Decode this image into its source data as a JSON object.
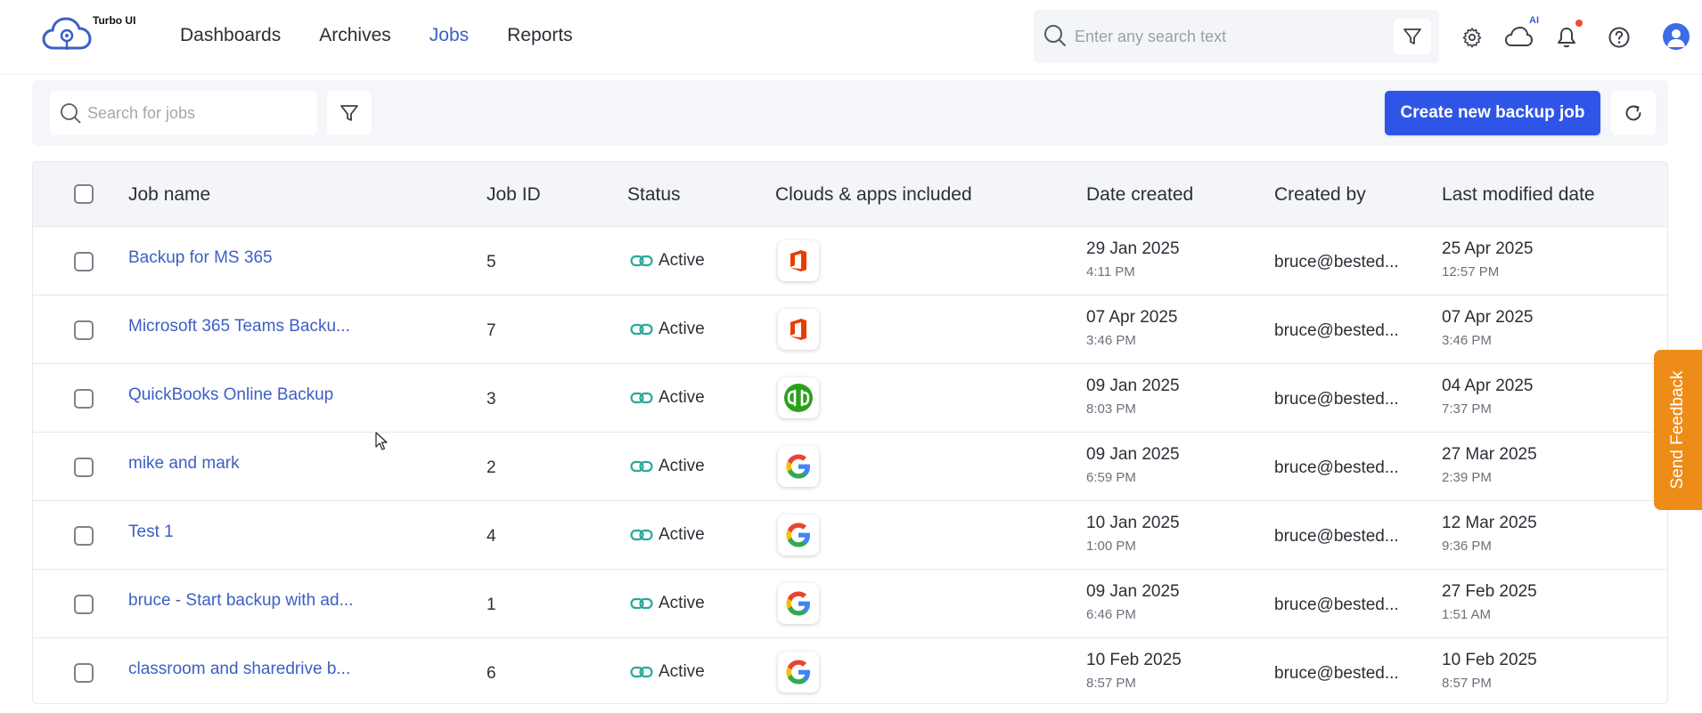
{
  "app": {
    "name": "Turbo UI"
  },
  "nav": {
    "items": [
      "Dashboards",
      "Archives",
      "Jobs",
      "Reports"
    ],
    "active": "Jobs"
  },
  "header": {
    "search_placeholder": "Enter any search text",
    "ai_badge": "AI"
  },
  "toolbar": {
    "search_placeholder": "Search for jobs",
    "create_label": "Create new backup job"
  },
  "table": {
    "columns": [
      "Job name",
      "Job ID",
      "Status",
      "Clouds & apps included",
      "Date created",
      "Created by",
      "Last modified date"
    ],
    "rows": [
      {
        "name": "Backup for MS 365",
        "id": "5",
        "status": "Active",
        "app": "office",
        "created_date": "29 Jan 2025",
        "created_time": "4:11 PM",
        "created_by": "bruce@bested...",
        "modified_date": "25 Apr 2025",
        "modified_time": "12:57 PM"
      },
      {
        "name": "Microsoft 365 Teams Backu...",
        "id": "7",
        "status": "Active",
        "app": "office",
        "created_date": "07 Apr 2025",
        "created_time": "3:46 PM",
        "created_by": "bruce@bested...",
        "modified_date": "07 Apr 2025",
        "modified_time": "3:46 PM"
      },
      {
        "name": "QuickBooks Online Backup",
        "id": "3",
        "status": "Active",
        "app": "quickbooks",
        "created_date": "09 Jan 2025",
        "created_time": "8:03 PM",
        "created_by": "bruce@bested...",
        "modified_date": "04 Apr 2025",
        "modified_time": "7:37 PM"
      },
      {
        "name": "mike and mark",
        "id": "2",
        "status": "Active",
        "app": "google",
        "created_date": "09 Jan 2025",
        "created_time": "6:59 PM",
        "created_by": "bruce@bested...",
        "modified_date": "27 Mar 2025",
        "modified_time": "2:39 PM"
      },
      {
        "name": "Test 1",
        "id": "4",
        "status": "Active",
        "app": "google",
        "created_date": "10 Jan 2025",
        "created_time": "1:00 PM",
        "created_by": "bruce@bested...",
        "modified_date": "12 Mar 2025",
        "modified_time": "9:36 PM"
      },
      {
        "name": "bruce - Start backup with ad...",
        "id": "1",
        "status": "Active",
        "app": "google",
        "created_date": "09 Jan 2025",
        "created_time": "6:46 PM",
        "created_by": "bruce@bested...",
        "modified_date": "27 Feb 2025",
        "modified_time": "1:51 AM"
      },
      {
        "name": "classroom and sharedrive b...",
        "id": "6",
        "status": "Active",
        "app": "google",
        "created_date": "10 Feb 2025",
        "created_time": "8:57 PM",
        "created_by": "bruce@bested...",
        "modified_date": "10 Feb 2025",
        "modified_time": "8:57 PM"
      }
    ]
  },
  "feedback": {
    "label": "Send Feedback"
  },
  "colors": {
    "primary": "#2f55e8",
    "link": "#3d5fc4",
    "status": "#2aa89a",
    "feedback": "#ee8c18",
    "notification": "#ef4b36"
  }
}
